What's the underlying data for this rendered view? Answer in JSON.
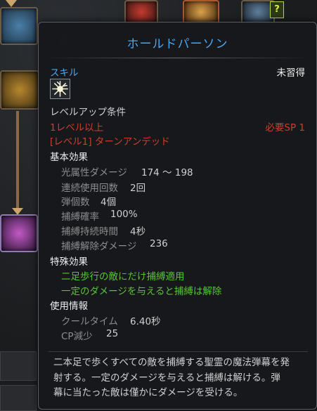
{
  "tooltip": {
    "title": "ホールドパーソン",
    "category": "スキル",
    "status": "未習得",
    "skill_icon": "burst-light-icon",
    "levelup_header": "レベルアップ条件",
    "req_level": "1レベル以上",
    "req_sp": "必要SP 1",
    "req_skill": "[レベル1] ターンアンデッド",
    "basic_header": "基本効果",
    "stats": [
      {
        "label": "光属性ダメージ",
        "value": "174 ～ 198"
      },
      {
        "label": "連続使用回数",
        "value": "2回"
      },
      {
        "label": "弾個数",
        "value": "4個"
      },
      {
        "label": "捕縛確率",
        "value": "100%"
      },
      {
        "label": "捕縛持続時間",
        "value": "4秒"
      },
      {
        "label": "捕縛解除ダメージ",
        "value": "236"
      }
    ],
    "special_header": "特殊効果",
    "special": [
      "二足歩行の敵にだけ捕縛適用",
      "一定のダメージを与えると捕縛は解除"
    ],
    "usage_header": "使用情報",
    "usage": [
      {
        "label": "クールタイム",
        "value": "6.40秒"
      },
      {
        "label": "CP減少",
        "value": "25"
      }
    ],
    "description": [
      "二本足で歩くすべての敵を捕縛する聖霊の魔法弾幕を発",
      "射する。一定のダメージを与えると捕縛は解ける。弾",
      "幕に当たった敵は僅かにダメージを受ける。"
    ]
  },
  "tree": {
    "help_badge": "?"
  },
  "colors": {
    "title_blue": "#4aa7ef",
    "requirement_red": "#c9402e",
    "special_green": "#58c335"
  }
}
